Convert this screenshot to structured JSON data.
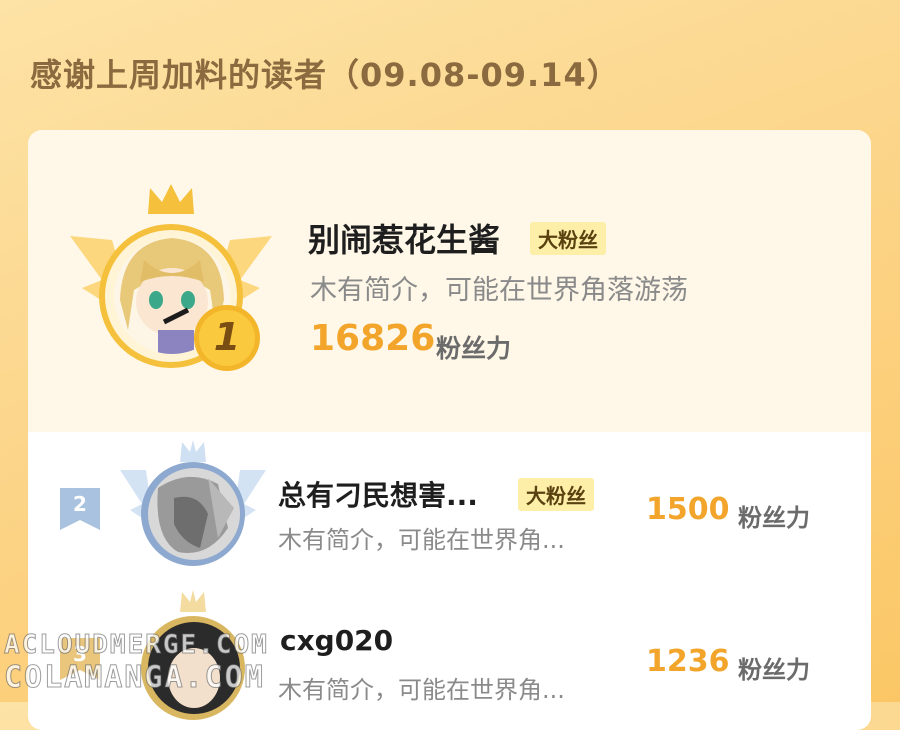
{
  "header": {
    "title": "感谢上周加料的读者（09.08-09.14）"
  },
  "leaderboard": {
    "entries": [
      {
        "rank": "1",
        "name": "别闹惹花生酱",
        "badge": "大粉丝",
        "intro": "木有简介，可能在世界角落游荡",
        "score": "16826",
        "score_unit": "粉丝力"
      },
      {
        "rank": "2",
        "name": "总有刁民想害...",
        "badge": "大粉丝",
        "intro": "木有简介，可能在世界角...",
        "score": "1500",
        "score_unit": "粉丝力"
      },
      {
        "rank": "3",
        "name": "cxg020",
        "badge": "",
        "intro": "木有简介，可能在世界角...",
        "score": "1236",
        "score_unit": "粉丝力"
      }
    ]
  },
  "watermark": {
    "line1": "ACLOUDMERGE.COM",
    "line2": "COLAMANGA.COM"
  },
  "colors": {
    "accent": "#f2a52a",
    "gold": "#f5c13c",
    "silver": "#a9c2e0",
    "badge_bg": "#fdeea8"
  }
}
